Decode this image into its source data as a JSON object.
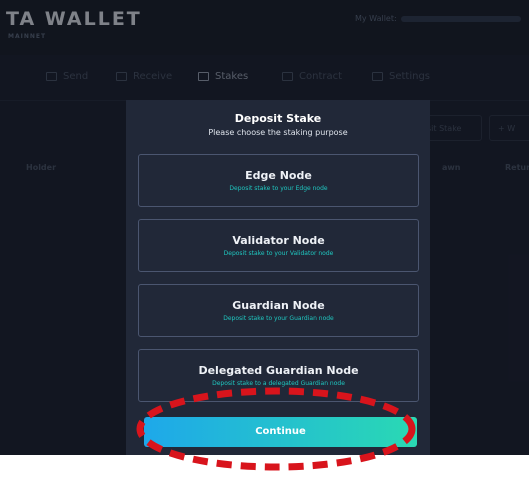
{
  "app": {
    "logo_text": "TA WALLET",
    "logo_sub": "MAINNET",
    "wallet_label": "My Wallet:"
  },
  "nav": {
    "items": [
      {
        "label": "Send",
        "icon": "send-icon"
      },
      {
        "label": "Receive",
        "icon": "receive-icon"
      },
      {
        "label": "Stakes",
        "icon": "stakes-icon",
        "active": true
      },
      {
        "label": "Contract",
        "icon": "contract-icon"
      },
      {
        "label": "Settings",
        "icon": "settings-icon"
      }
    ]
  },
  "stakes_page": {
    "columns": [
      "Holder",
      "awn",
      "Retur"
    ],
    "buttons": [
      "sit Stake",
      "+ W"
    ]
  },
  "modal": {
    "title": "Deposit Stake",
    "subtitle": "Please choose the staking purpose",
    "options": [
      {
        "title": "Edge Node",
        "desc": "Deposit stake to your Edge node"
      },
      {
        "title": "Validator Node",
        "desc": "Deposit stake to your Validator node"
      },
      {
        "title": "Guardian Node",
        "desc": "Deposit stake to your Guardian node"
      },
      {
        "title": "Delegated Guardian Node",
        "desc": "Deposit stake to a delegated Guardian node"
      }
    ],
    "continue_label": "Continue"
  },
  "colors": {
    "accent_start": "#1ea8ea",
    "accent_end": "#2ad9b3",
    "annotation": "#d8141c"
  }
}
